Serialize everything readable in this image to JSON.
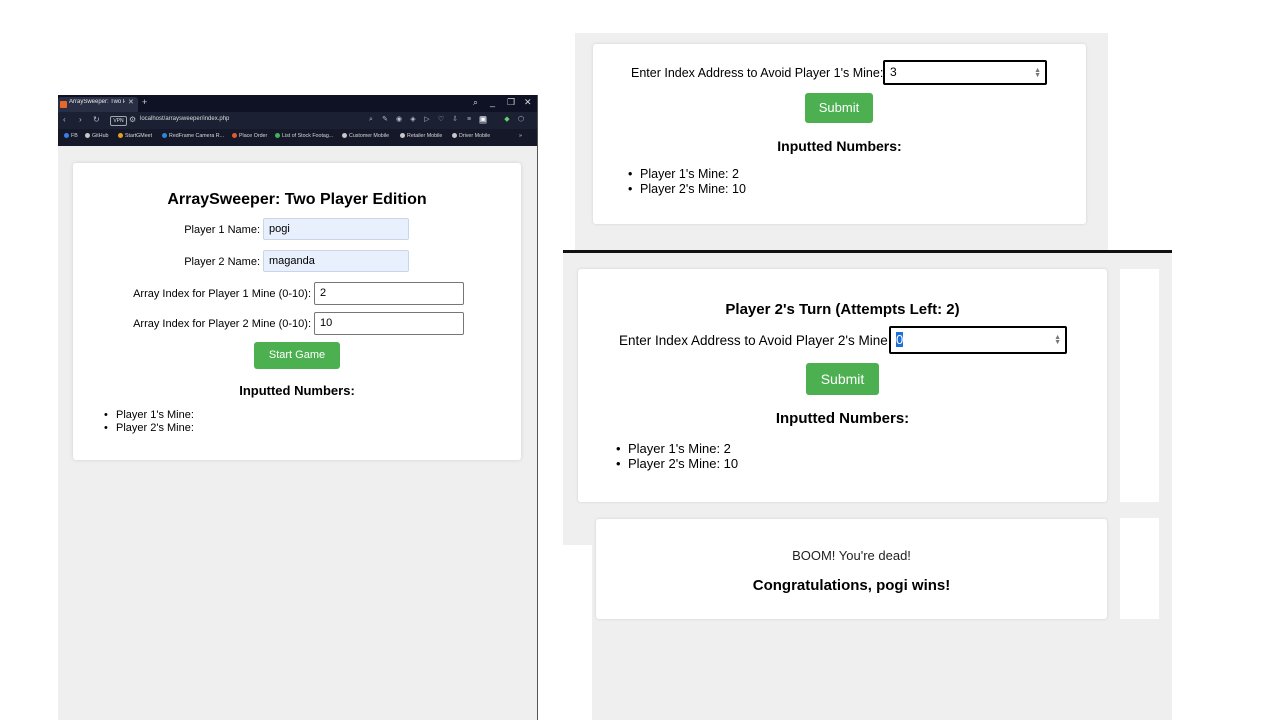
{
  "browser": {
    "tab_title": "ArraySweeper: Two Pl...",
    "url": "localhost/arraysweeper/index.php",
    "vpn_label": "VPN",
    "bookmarks": [
      "FB",
      "GitHub",
      "StartGMeet",
      "RedFrame Camera R...",
      "Place Order",
      "List of Stock Footag...",
      "Customer Mobile",
      "Retailer Mobile",
      "Driver Mobile"
    ],
    "accent_color": "#0e1224"
  },
  "setup": {
    "title": "ArraySweeper: Two Player Edition",
    "player1_label": "Player 1 Name:",
    "player1_value": "pogi",
    "player2_label": "Player 2 Name:",
    "player2_value": "maganda",
    "mine1_label": "Array Index for Player 1 Mine (0-10):",
    "mine1_value": "2",
    "mine2_label": "Array Index for Player 2 Mine (0-10):",
    "mine2_value": "10",
    "start_button": "Start Game",
    "inputted_title": "Inputted Numbers:",
    "list": [
      "Player 1's Mine:",
      "Player 2's Mine:"
    ]
  },
  "turn1": {
    "prompt_label": "Enter Index Address to Avoid Player 1's Mine:",
    "input_value": "3",
    "submit_label": "Submit",
    "inputted_title": "Inputted Numbers:",
    "list": [
      "Player 1's Mine: 2",
      "Player 2's Mine: 10"
    ]
  },
  "turn2": {
    "heading": "Player 2's Turn (Attempts Left: 2)",
    "prompt_label": "Enter Index Address to Avoid Player 2's Mine:",
    "input_value": "0",
    "submit_label": "Submit",
    "inputted_title": "Inputted Numbers:",
    "list": [
      "Player 1's Mine: 2",
      "Player 2's Mine: 10"
    ]
  },
  "result": {
    "message": "BOOM! You're dead!",
    "winner": "Congratulations, pogi wins!"
  },
  "colors": {
    "button_green": "#4caf50",
    "page_bg": "#efefef",
    "autofill_bg": "#e8f0fe"
  }
}
